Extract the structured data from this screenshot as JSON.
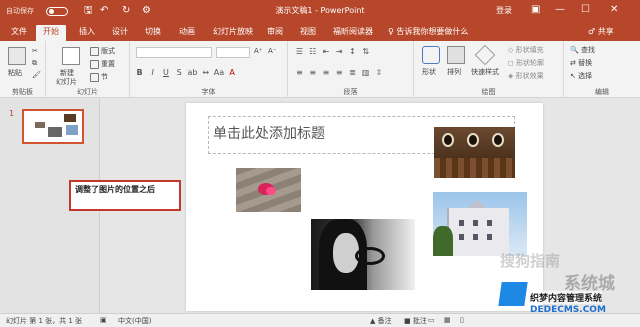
{
  "titlebar": {
    "autosave": "自动保存",
    "doc_title": "演示文稿1 - PowerPoint",
    "login": "登录",
    "qa_save": "🖫",
    "qa_undo": "↶",
    "qa_redo": "↻",
    "qa_more": "⚙",
    "minimize": "—",
    "restore": "☐",
    "close": "✕",
    "options": "▣"
  },
  "tabs": [
    "文件",
    "开始",
    "插入",
    "设计",
    "切换",
    "动画",
    "幻灯片放映",
    "审阅",
    "视图",
    "福昕阅读器"
  ],
  "active_tab": "开始",
  "tellme": "♀ 告诉我你想要做什么",
  "share": "♂ 共享",
  "ribbon": {
    "clipboard": {
      "paste": "粘贴",
      "label": "剪贴板"
    },
    "slides": {
      "new_slide": "新建",
      "new_slide2": "幻灯片",
      "layout": "版式",
      "reset": "重置",
      "section": "节",
      "label": "幻灯片"
    },
    "font": {
      "bold": "B",
      "italic": "I",
      "underline": "U",
      "strike": "S",
      "shadow": "ab",
      "label": "字体"
    },
    "paragraph": {
      "label": "段落"
    },
    "drawing": {
      "shapes": "形状",
      "arrange": "排列",
      "quick_styles": "快速样式",
      "fill": "形状填充",
      "outline": "形状轮廓",
      "effects": "形状效果",
      "label": "绘图"
    },
    "editing": {
      "find": "查找",
      "replace": "替换",
      "select": "选择",
      "label": "编辑"
    }
  },
  "thumbnails": {
    "slide_number": "1"
  },
  "callout": {
    "text": "调整了图片的位置之后"
  },
  "slide": {
    "title_placeholder": "单击此处添加标题"
  },
  "watermarks": {
    "sogou": "搜狗指南",
    "xitong": "系统城",
    "site1": "织梦内容管理系统",
    "site2": "DEDECMS.COM"
  },
  "statusbar": {
    "slide_info": "幻灯片 第 1 张，共 1 张",
    "language": "中文(中国)",
    "notes": "▲ 备注",
    "comments": "■ 批注"
  },
  "colors": {
    "accent": "#b7472a",
    "callout_border": "#c0392b"
  }
}
